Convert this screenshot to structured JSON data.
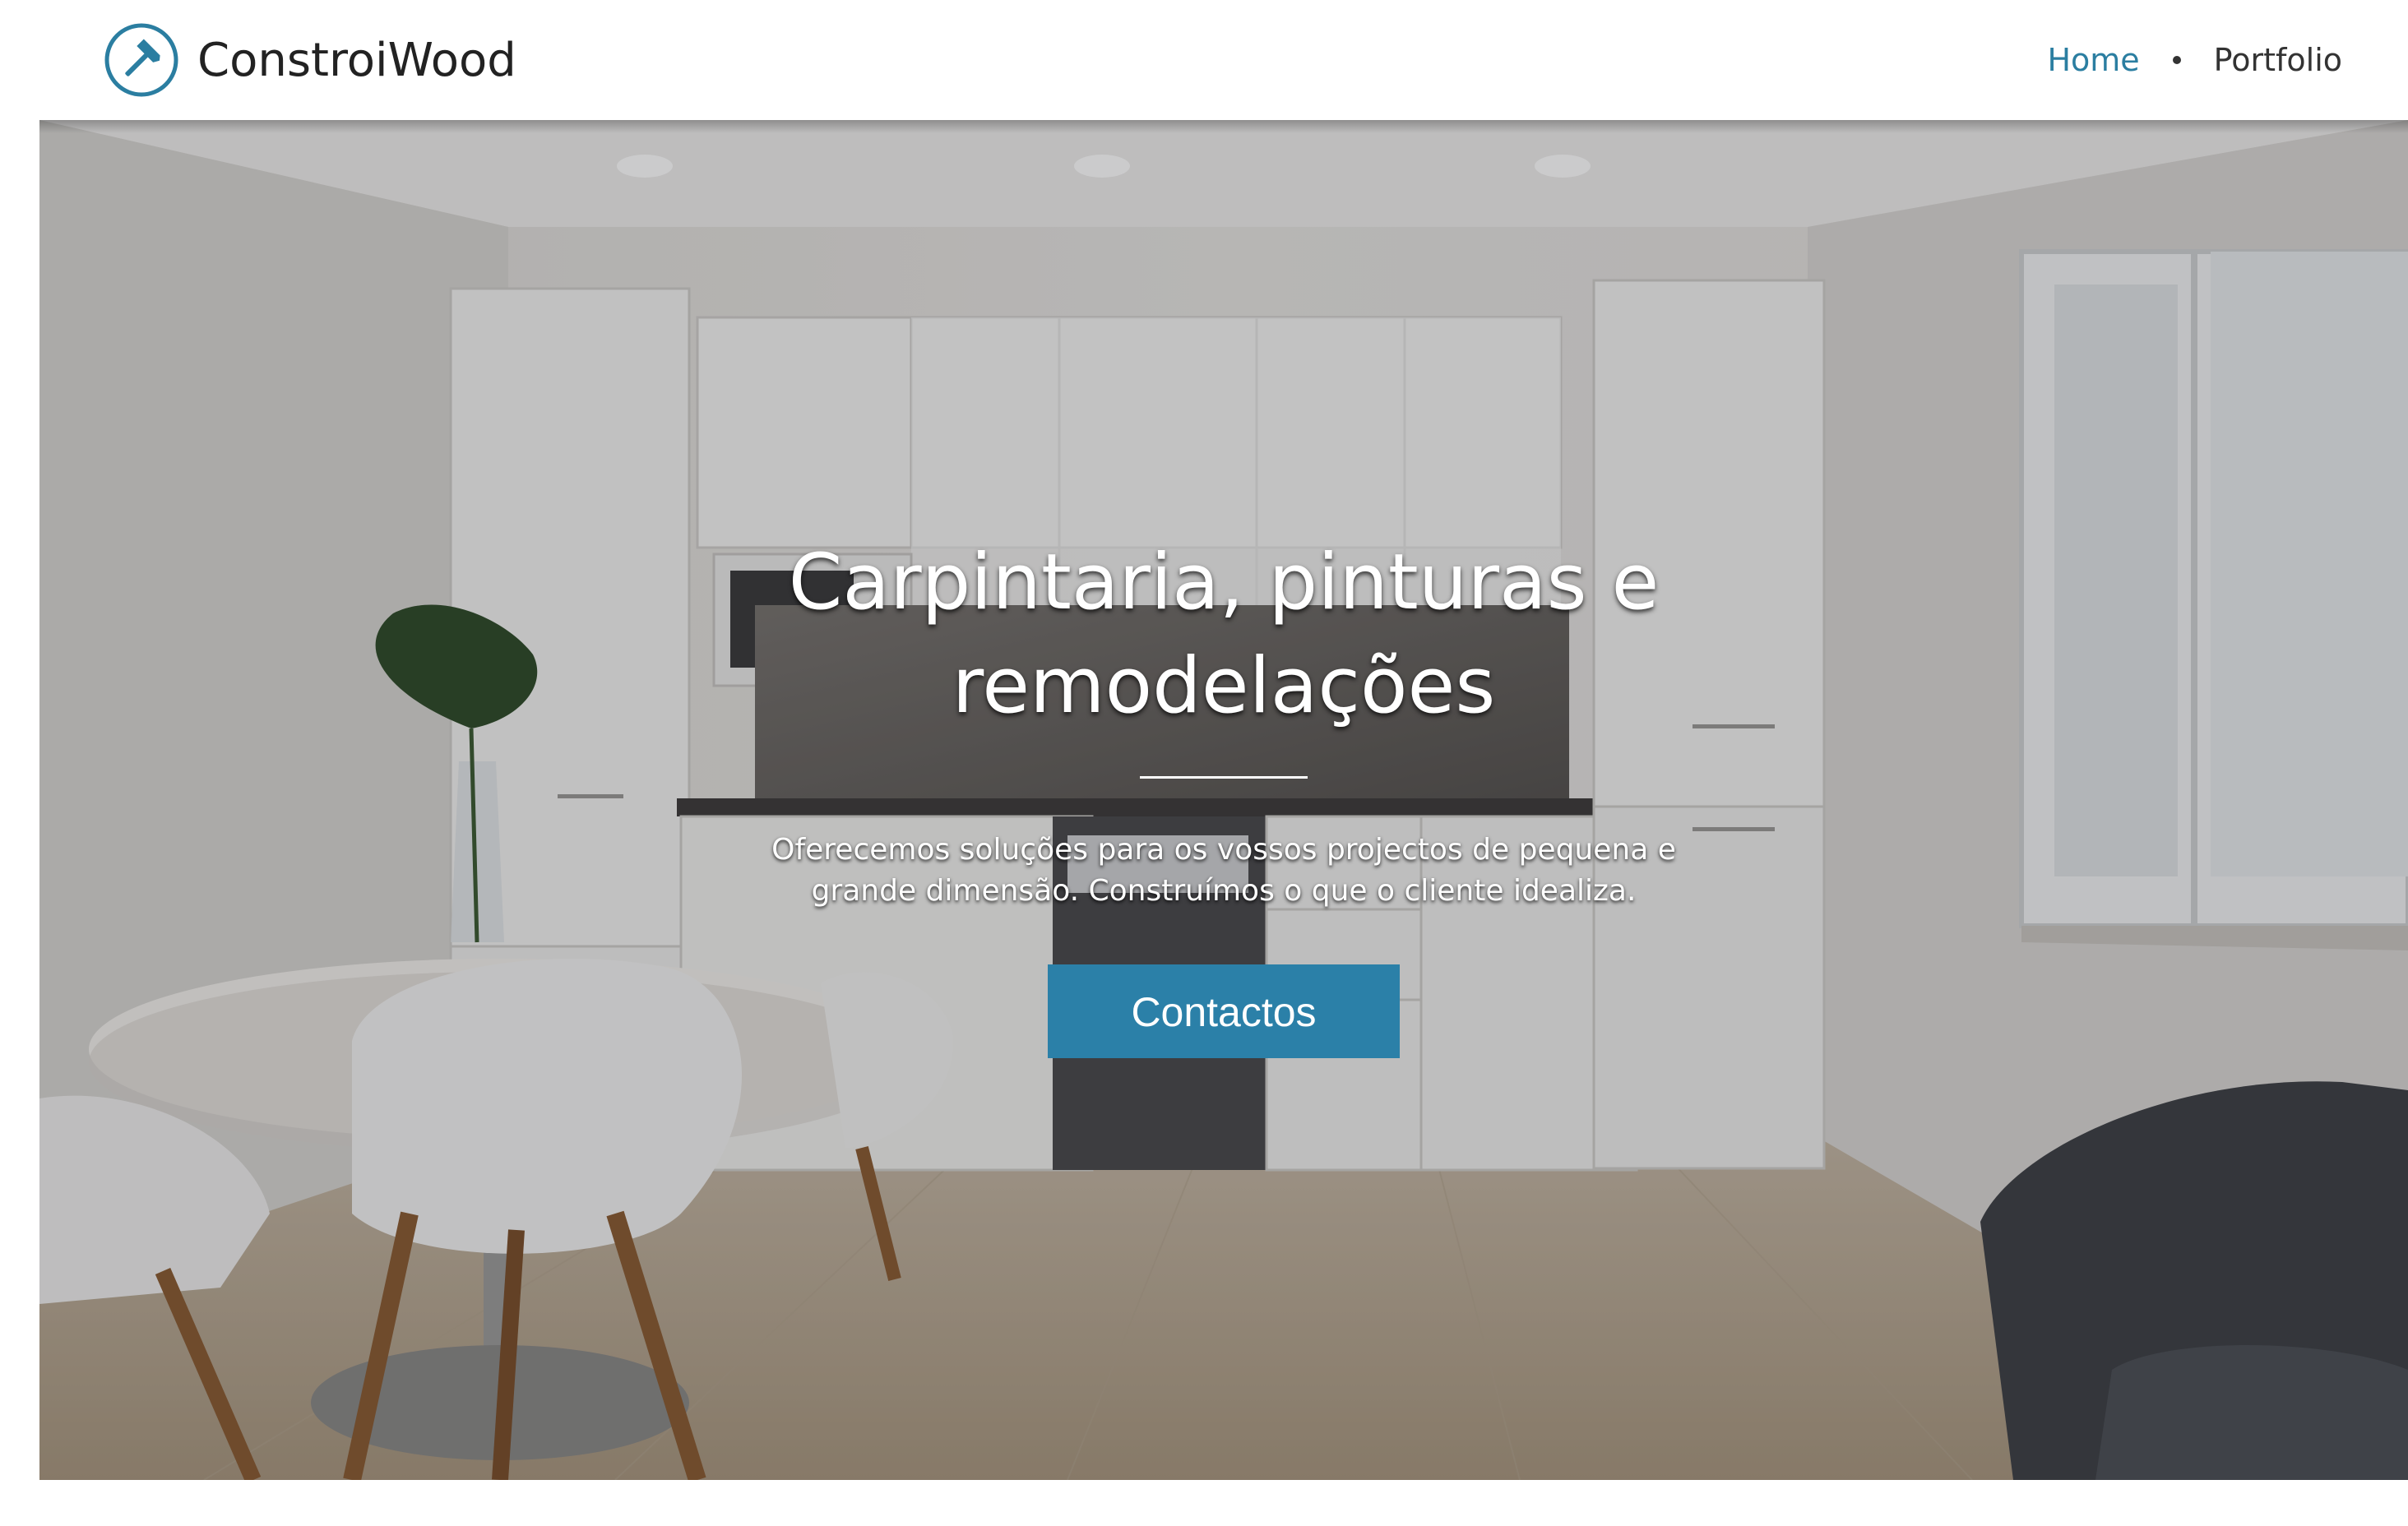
{
  "header": {
    "brand_name": "ConstroiWood",
    "brand_icon": "hammer-icon",
    "nav": [
      {
        "label": "Home",
        "active": true
      },
      {
        "label": "Portfolio",
        "active": false
      }
    ]
  },
  "hero": {
    "title": "Carpintaria, pinturas e remodelações",
    "subtitle": "Oferecemos soluções para os vossos projectos de pequena e grande dimensão. Construímos o que o cliente idealiza.",
    "cta_label": "Contactos",
    "background": "kitchen-interior-photo"
  },
  "colors": {
    "accent": "#2b7ea1",
    "button": "#2b80a8",
    "text_dark": "#222222"
  }
}
